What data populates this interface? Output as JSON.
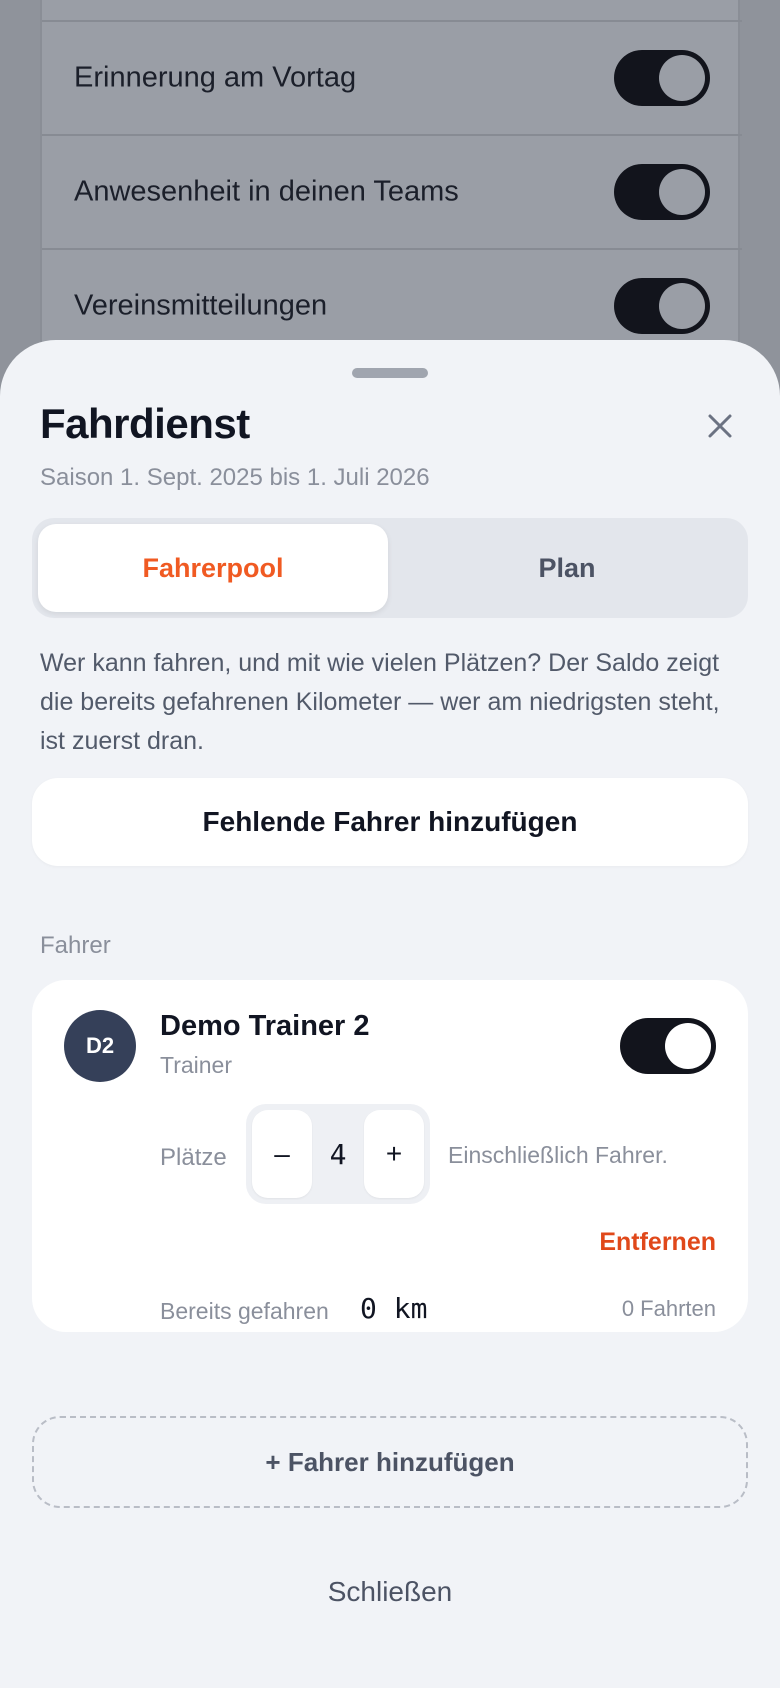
{
  "background": {
    "settings": [
      {
        "label": "Erinnerung am Vortag",
        "enabled": true
      },
      {
        "label": "Anwesenheit in deinen Teams",
        "enabled": true
      },
      {
        "label": "Vereinsmitteilungen",
        "enabled": true
      }
    ]
  },
  "sheet": {
    "title": "Fahrdienst",
    "subtitle": "Saison 1. Sept. 2025 bis 1. Juli 2026",
    "tabs": [
      {
        "label": "Fahrerpool",
        "active": true
      },
      {
        "label": "Plan",
        "active": false
      }
    ],
    "description": "Wer kann fahren, und mit wie vielen Plätzen? Der Saldo zeigt die bereits gefahrenen Kilometer — wer am niedrigsten steht, ist zuerst dran.",
    "add_missing_label": "Fehlende Fahrer hinzufügen",
    "section_label": "Fahrer",
    "drivers": [
      {
        "initials": "D2",
        "name": "Demo Trainer 2",
        "role": "Trainer",
        "enabled": true,
        "seats_label": "Plätze",
        "minus_label": "–",
        "seats": "4",
        "plus_label": "+",
        "seats_hint": "Einschließlich Fahrer.",
        "remove_label": "Entfernen",
        "driven_label": "Bereits gefahren",
        "driven_value": "0 km",
        "trips": "0 Fahrten"
      }
    ],
    "add_driver_label": "+ Fahrer hinzufügen",
    "close_label": "Schließen"
  },
  "colors": {
    "accent": "#f05a22",
    "danger": "#e0481a",
    "toggle_on": "#12141c",
    "avatar": "#354059"
  }
}
